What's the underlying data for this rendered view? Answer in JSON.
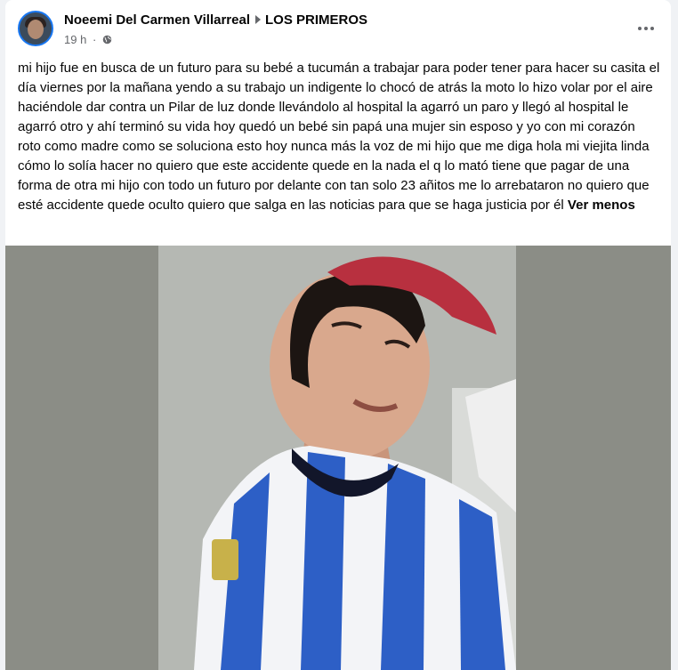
{
  "post": {
    "author": "Noeemi Del Carmen Villarreal",
    "group": "LOS PRIMEROS",
    "time": "19 h",
    "separator": "·",
    "privacy_icon": "globe-icon",
    "more_icon": "more-options-icon",
    "text": "mi hijo fue en busca de un futuro para su bebé a tucumán a trabajar para poder tener para hacer su casita el día viernes por la mañana yendo a su trabajo un indigente lo chocó de atrás la moto lo hizo volar por el aire haciéndole dar contra un Pilar de luz donde llevándolo al hospital la agarró un paro y llegó al hospital le agarró otro y ahí terminó su vida hoy quedó un bebé sin papá una mujer sin esposo y yo con mi corazón roto como madre como se soluciona esto hoy nunca más la voz de mi hijo que me diga hola mi viejita linda cómo lo solía hacer no quiero que este accidente quede en la nada el q lo mató tiene que pagar de una forma de otra mi hijo con todo un futuro por delante con tan solo 23 añitos me lo arrebataron no quiero que esté accidente quede oculto quiero que salga en las noticias para que se haga justicia por él",
    "see_less": "Ver menos"
  },
  "colors": {
    "background": "#f0f2f5",
    "card": "#ffffff",
    "text": "#050505",
    "secondary_text": "#65676b",
    "jersey_blue": "#2d5fc6",
    "cap_red": "#b8303f"
  }
}
